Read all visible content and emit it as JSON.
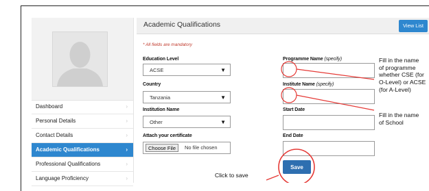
{
  "sidebar": {
    "menu": [
      {
        "label": "Dashboard",
        "active": false
      },
      {
        "label": "Personal Details",
        "active": false
      },
      {
        "label": "Contact Details",
        "active": false
      },
      {
        "label": "Academic Qualifications",
        "active": true
      },
      {
        "label": "Professional Qualifications",
        "active": false
      },
      {
        "label": "Language Proficiency",
        "active": false
      }
    ],
    "chevron": "›"
  },
  "main": {
    "title": "Academic Qualifications",
    "view_list_label": "View List",
    "mandatory_note": "* All fields are mandatory",
    "education_level": {
      "label": "Education Level",
      "value": "ACSE"
    },
    "country": {
      "label": "Country",
      "value": "Tanzania"
    },
    "institution_name": {
      "label": "Institution Name",
      "value": "Other"
    },
    "certificate": {
      "label": "Attach your certificate",
      "button": "Choose File",
      "status": "No file chosen"
    },
    "programme_name": {
      "label": "Programme Name",
      "spec": "(specify)"
    },
    "institute_name": {
      "label": "Institute Name",
      "spec": "(specify)"
    },
    "start_date": {
      "label": "Start Date"
    },
    "end_date": {
      "label": "End Date"
    },
    "save_label": "Save",
    "select_arrow": "▼"
  },
  "annotations": {
    "programme_note": [
      "Fill in the name",
      "of programme",
      "whether CSE (for",
      "O-Level) or ACSE",
      "(for A-Level)"
    ],
    "school_note": [
      "Fill in the name",
      "of School"
    ],
    "save_note": "Click to save"
  },
  "colors": {
    "accent": "#2e87cf",
    "save_button": "#2e6fb0",
    "annotation": "#e53935",
    "mandatory": "#c0392b"
  }
}
